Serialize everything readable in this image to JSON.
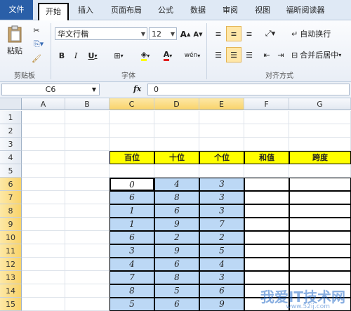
{
  "tabs": [
    {
      "label": "文件",
      "cls": "file"
    },
    {
      "label": "开始",
      "cls": "active"
    },
    {
      "label": "插入",
      "cls": ""
    },
    {
      "label": "页面布局",
      "cls": ""
    },
    {
      "label": "公式",
      "cls": ""
    },
    {
      "label": "数据",
      "cls": ""
    },
    {
      "label": "审阅",
      "cls": ""
    },
    {
      "label": "视图",
      "cls": ""
    },
    {
      "label": "福昕阅读器",
      "cls": ""
    }
  ],
  "ribbon": {
    "clipboard": {
      "paste_label": "粘贴",
      "group_label": "剪贴板"
    },
    "font": {
      "name": "华文行楷",
      "size": "12",
      "grow": "A",
      "shrink": "A",
      "bold": "B",
      "italic": "I",
      "underline": "U",
      "wen": "wén",
      "group_label": "字体"
    },
    "align": {
      "wrap": "自动换行",
      "merge": "合并后居中",
      "group_label": "对齐方式"
    }
  },
  "formula_bar": {
    "name_box": "C6",
    "fx": "fx",
    "value": "0"
  },
  "columns": [
    "A",
    "B",
    "C",
    "D",
    "E",
    "F",
    "G"
  ],
  "rows": [
    "1",
    "2",
    "3",
    "4",
    "5",
    "6",
    "7",
    "8",
    "9",
    "10",
    "11",
    "12",
    "13",
    "14",
    "15"
  ],
  "table": {
    "headers": [
      "百位",
      "十位",
      "个位",
      "和值",
      "跨度"
    ],
    "data": [
      [
        "0",
        "4",
        "3"
      ],
      [
        "6",
        "8",
        "3"
      ],
      [
        "1",
        "6",
        "3"
      ],
      [
        "1",
        "9",
        "7"
      ],
      [
        "6",
        "2",
        "2"
      ],
      [
        "3",
        "9",
        "5"
      ],
      [
        "4",
        "6",
        "4"
      ],
      [
        "7",
        "8",
        "3"
      ],
      [
        "8",
        "5",
        "6"
      ],
      [
        "5",
        "6",
        "9"
      ]
    ]
  },
  "watermark": {
    "main": "我爱IT技术网",
    "sub": "www.52ij.com"
  },
  "colors": {
    "header_fill": "#ffff00",
    "selection_fill": "#bcd8f5",
    "ribbon_accent": "#2a5fa8"
  }
}
